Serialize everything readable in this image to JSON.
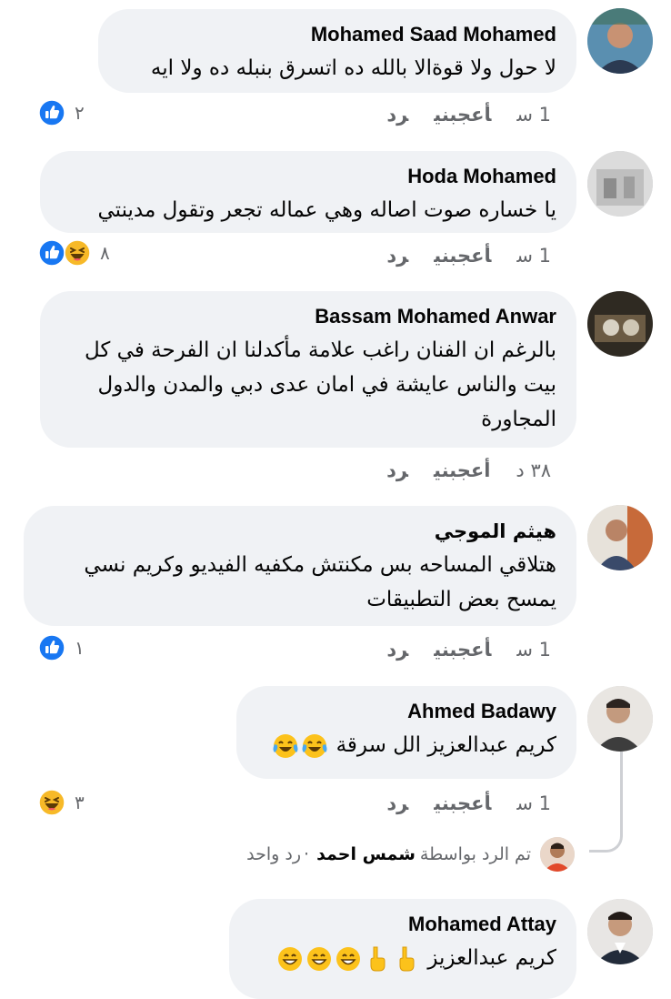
{
  "comments": [
    {
      "author": "Mohamed Saad Mohamed",
      "lines": [
        "لا حول ولا قوةالا بالله ده اتسرق بنبله ده ولا ايه"
      ],
      "time": "1 س",
      "like_label": "أعجبني",
      "reply_label": "رد",
      "reaction_count": "٢",
      "reactions": [
        "like-icon"
      ]
    },
    {
      "author": "Hoda Mohamed",
      "lines": [
        "يا خساره صوت اصاله وهي عماله تجعر وتقول مدينتي"
      ],
      "time": "1 س",
      "like_label": "أعجبني",
      "reply_label": "رد",
      "reaction_count": "٨",
      "reactions": [
        "like-icon",
        "haha-icon"
      ]
    },
    {
      "author": "Bassam Mohamed Anwar",
      "lines": [
        "بالرغم ان الفنان راغب علامة مأكدلنا ان الفرحة في كل",
        "بيت والناس عايشة في امان عدى دبي والمدن والدول",
        "المجاورة"
      ],
      "time": "٣٨ د",
      "like_label": "أعجبني",
      "reply_label": "رد"
    },
    {
      "author": "هيثم الموجي",
      "lines": [
        "هتلاقي المساحه بس مكنتش مكفيه الفيديو وكريم نسي",
        "يمسح بعض التطبيقات"
      ],
      "time": "1 س",
      "like_label": "أعجبني",
      "reply_label": "رد",
      "reaction_count": "١",
      "reactions": [
        "like-icon"
      ]
    },
    {
      "author": "Ahmed Badawy",
      "text": "كريم عبدالعزيز الل سرقة",
      "emojis": [
        "tears-of-joy-emoji",
        "tears-of-joy-emoji"
      ],
      "time": "1 س",
      "like_label": "أعجبني",
      "reply_label": "رد",
      "reaction_count": "٣",
      "reactions": [
        "haha-icon"
      ]
    },
    {
      "author": "Mohamed Attay",
      "text": "كريم عبدالعزيز",
      "emojis": [
        "pointing-down-emoji",
        "pointing-down-emoji",
        "grinning-emoji",
        "grinning-emoji",
        "grinning-emoji"
      ]
    }
  ],
  "reply_summary": {
    "prefix": "تم الرد بواسطة",
    "replier": "شمس احمد",
    "separator": "·",
    "count_label": "رد واحد"
  },
  "colors": {
    "bubble": "#f0f2f5",
    "meta_text": "#65676b",
    "like_blue": "#1877f2",
    "haha_yellow": "#f7b928"
  }
}
